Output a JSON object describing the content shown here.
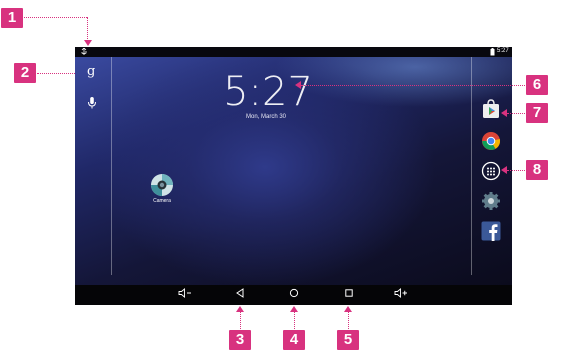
{
  "callouts": {
    "c1": "1",
    "c2": "2",
    "c3": "3",
    "c4": "4",
    "c5": "5",
    "c6": "6",
    "c7": "7",
    "c8": "8"
  },
  "status_bar": {
    "time": "5:27"
  },
  "clock": {
    "time": "5:27",
    "date": "Mon, March 30"
  },
  "desktop": {
    "camera_label": "Camera"
  },
  "side_icons": [
    "google-search-icon",
    "microphone-icon"
  ],
  "dock_icons": [
    "play-store-icon",
    "chrome-icon",
    "all-apps-icon",
    "settings-icon",
    "facebook-icon"
  ],
  "nav_icons": [
    "volume-down-icon",
    "back-icon",
    "home-icon",
    "recent-apps-icon",
    "volume-up-icon"
  ],
  "colors": {
    "callout": "#d8327f",
    "wallpaper": "#202868"
  }
}
